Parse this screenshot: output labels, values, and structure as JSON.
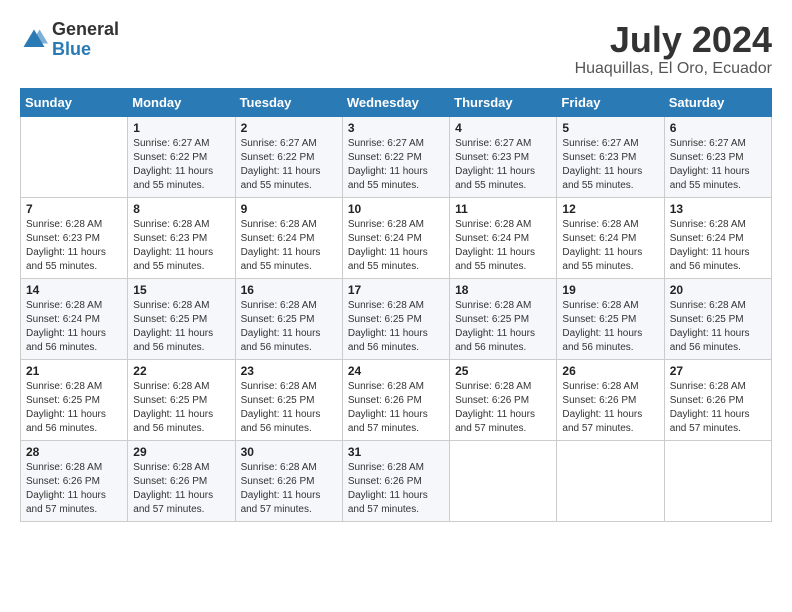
{
  "header": {
    "logo_general": "General",
    "logo_blue": "Blue",
    "title": "July 2024",
    "location": "Huaquillas, El Oro, Ecuador"
  },
  "calendar": {
    "days_of_week": [
      "Sunday",
      "Monday",
      "Tuesday",
      "Wednesday",
      "Thursday",
      "Friday",
      "Saturday"
    ],
    "weeks": [
      [
        {
          "day": "",
          "info": ""
        },
        {
          "day": "1",
          "info": "Sunrise: 6:27 AM\nSunset: 6:22 PM\nDaylight: 11 hours\nand 55 minutes."
        },
        {
          "day": "2",
          "info": "Sunrise: 6:27 AM\nSunset: 6:22 PM\nDaylight: 11 hours\nand 55 minutes."
        },
        {
          "day": "3",
          "info": "Sunrise: 6:27 AM\nSunset: 6:22 PM\nDaylight: 11 hours\nand 55 minutes."
        },
        {
          "day": "4",
          "info": "Sunrise: 6:27 AM\nSunset: 6:23 PM\nDaylight: 11 hours\nand 55 minutes."
        },
        {
          "day": "5",
          "info": "Sunrise: 6:27 AM\nSunset: 6:23 PM\nDaylight: 11 hours\nand 55 minutes."
        },
        {
          "day": "6",
          "info": "Sunrise: 6:27 AM\nSunset: 6:23 PM\nDaylight: 11 hours\nand 55 minutes."
        }
      ],
      [
        {
          "day": "7",
          "info": "Sunrise: 6:28 AM\nSunset: 6:23 PM\nDaylight: 11 hours\nand 55 minutes."
        },
        {
          "day": "8",
          "info": "Sunrise: 6:28 AM\nSunset: 6:23 PM\nDaylight: 11 hours\nand 55 minutes."
        },
        {
          "day": "9",
          "info": "Sunrise: 6:28 AM\nSunset: 6:24 PM\nDaylight: 11 hours\nand 55 minutes."
        },
        {
          "day": "10",
          "info": "Sunrise: 6:28 AM\nSunset: 6:24 PM\nDaylight: 11 hours\nand 55 minutes."
        },
        {
          "day": "11",
          "info": "Sunrise: 6:28 AM\nSunset: 6:24 PM\nDaylight: 11 hours\nand 55 minutes."
        },
        {
          "day": "12",
          "info": "Sunrise: 6:28 AM\nSunset: 6:24 PM\nDaylight: 11 hours\nand 55 minutes."
        },
        {
          "day": "13",
          "info": "Sunrise: 6:28 AM\nSunset: 6:24 PM\nDaylight: 11 hours\nand 56 minutes."
        }
      ],
      [
        {
          "day": "14",
          "info": "Sunrise: 6:28 AM\nSunset: 6:24 PM\nDaylight: 11 hours\nand 56 minutes."
        },
        {
          "day": "15",
          "info": "Sunrise: 6:28 AM\nSunset: 6:25 PM\nDaylight: 11 hours\nand 56 minutes."
        },
        {
          "day": "16",
          "info": "Sunrise: 6:28 AM\nSunset: 6:25 PM\nDaylight: 11 hours\nand 56 minutes."
        },
        {
          "day": "17",
          "info": "Sunrise: 6:28 AM\nSunset: 6:25 PM\nDaylight: 11 hours\nand 56 minutes."
        },
        {
          "day": "18",
          "info": "Sunrise: 6:28 AM\nSunset: 6:25 PM\nDaylight: 11 hours\nand 56 minutes."
        },
        {
          "day": "19",
          "info": "Sunrise: 6:28 AM\nSunset: 6:25 PM\nDaylight: 11 hours\nand 56 minutes."
        },
        {
          "day": "20",
          "info": "Sunrise: 6:28 AM\nSunset: 6:25 PM\nDaylight: 11 hours\nand 56 minutes."
        }
      ],
      [
        {
          "day": "21",
          "info": "Sunrise: 6:28 AM\nSunset: 6:25 PM\nDaylight: 11 hours\nand 56 minutes."
        },
        {
          "day": "22",
          "info": "Sunrise: 6:28 AM\nSunset: 6:25 PM\nDaylight: 11 hours\nand 56 minutes."
        },
        {
          "day": "23",
          "info": "Sunrise: 6:28 AM\nSunset: 6:25 PM\nDaylight: 11 hours\nand 56 minutes."
        },
        {
          "day": "24",
          "info": "Sunrise: 6:28 AM\nSunset: 6:26 PM\nDaylight: 11 hours\nand 57 minutes."
        },
        {
          "day": "25",
          "info": "Sunrise: 6:28 AM\nSunset: 6:26 PM\nDaylight: 11 hours\nand 57 minutes."
        },
        {
          "day": "26",
          "info": "Sunrise: 6:28 AM\nSunset: 6:26 PM\nDaylight: 11 hours\nand 57 minutes."
        },
        {
          "day": "27",
          "info": "Sunrise: 6:28 AM\nSunset: 6:26 PM\nDaylight: 11 hours\nand 57 minutes."
        }
      ],
      [
        {
          "day": "28",
          "info": "Sunrise: 6:28 AM\nSunset: 6:26 PM\nDaylight: 11 hours\nand 57 minutes."
        },
        {
          "day": "29",
          "info": "Sunrise: 6:28 AM\nSunset: 6:26 PM\nDaylight: 11 hours\nand 57 minutes."
        },
        {
          "day": "30",
          "info": "Sunrise: 6:28 AM\nSunset: 6:26 PM\nDaylight: 11 hours\nand 57 minutes."
        },
        {
          "day": "31",
          "info": "Sunrise: 6:28 AM\nSunset: 6:26 PM\nDaylight: 11 hours\nand 57 minutes."
        },
        {
          "day": "",
          "info": ""
        },
        {
          "day": "",
          "info": ""
        },
        {
          "day": "",
          "info": ""
        }
      ]
    ]
  }
}
